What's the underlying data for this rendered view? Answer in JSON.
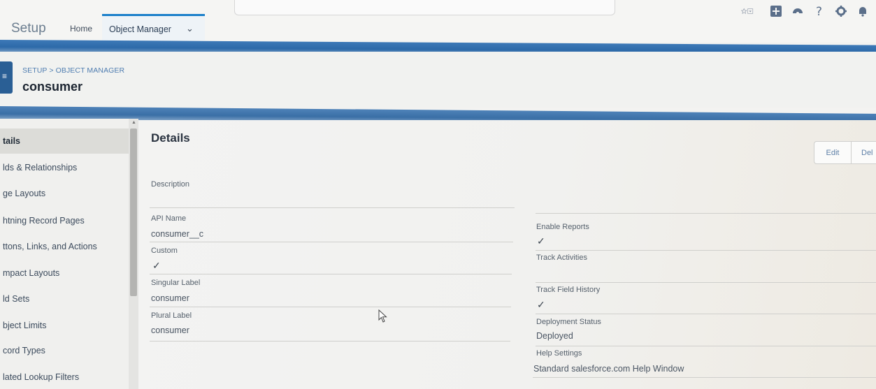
{
  "header": {
    "app_name": "Setup",
    "nav": {
      "home": "Home",
      "object_manager": "Object Manager",
      "object_manager_chevron": "⌄"
    },
    "icons": [
      "favorites-icon",
      "add-icon",
      "trailhead-icon",
      "help-icon",
      "gear-icon",
      "notifications-icon"
    ]
  },
  "page": {
    "breadcrumb": "SETUP > OBJECT MANAGER",
    "title": "consumer"
  },
  "sidebar": {
    "items": [
      {
        "label": "tails"
      },
      {
        "label": "lds & Relationships"
      },
      {
        "label": "ge Layouts"
      },
      {
        "label": "htning Record Pages"
      },
      {
        "label": "ttons, Links, and Actions"
      },
      {
        "label": "mpact Layouts"
      },
      {
        "label": "ld Sets"
      },
      {
        "label": "bject Limits"
      },
      {
        "label": "cord Types"
      },
      {
        "label": "lated Lookup Filters"
      }
    ]
  },
  "details": {
    "title": "Details",
    "buttons": {
      "edit": "Edit",
      "delete": "Del"
    },
    "left": {
      "description_label": "Description",
      "api_name_label": "API Name",
      "api_name_value": "consumer__c",
      "custom_label": "Custom",
      "custom_value": "✓",
      "singular_label_label": "Singular Label",
      "singular_label_value": "consumer",
      "plural_label_label": "Plural Label",
      "plural_label_value": "consumer"
    },
    "right": {
      "enable_reports_label": "Enable Reports",
      "enable_reports_value": "✓",
      "track_activities_label": "Track Activities",
      "track_field_history_label": "Track Field History",
      "track_field_history_value": "✓",
      "deployment_status_label": "Deployment Status",
      "deployment_status_value": "Deployed",
      "help_settings_label": "Help Settings",
      "help_settings_value": "Standard salesforce.com Help Window"
    }
  },
  "colors": {
    "brand_blue": "#2d6aa9",
    "link_blue": "#4f7db0"
  }
}
